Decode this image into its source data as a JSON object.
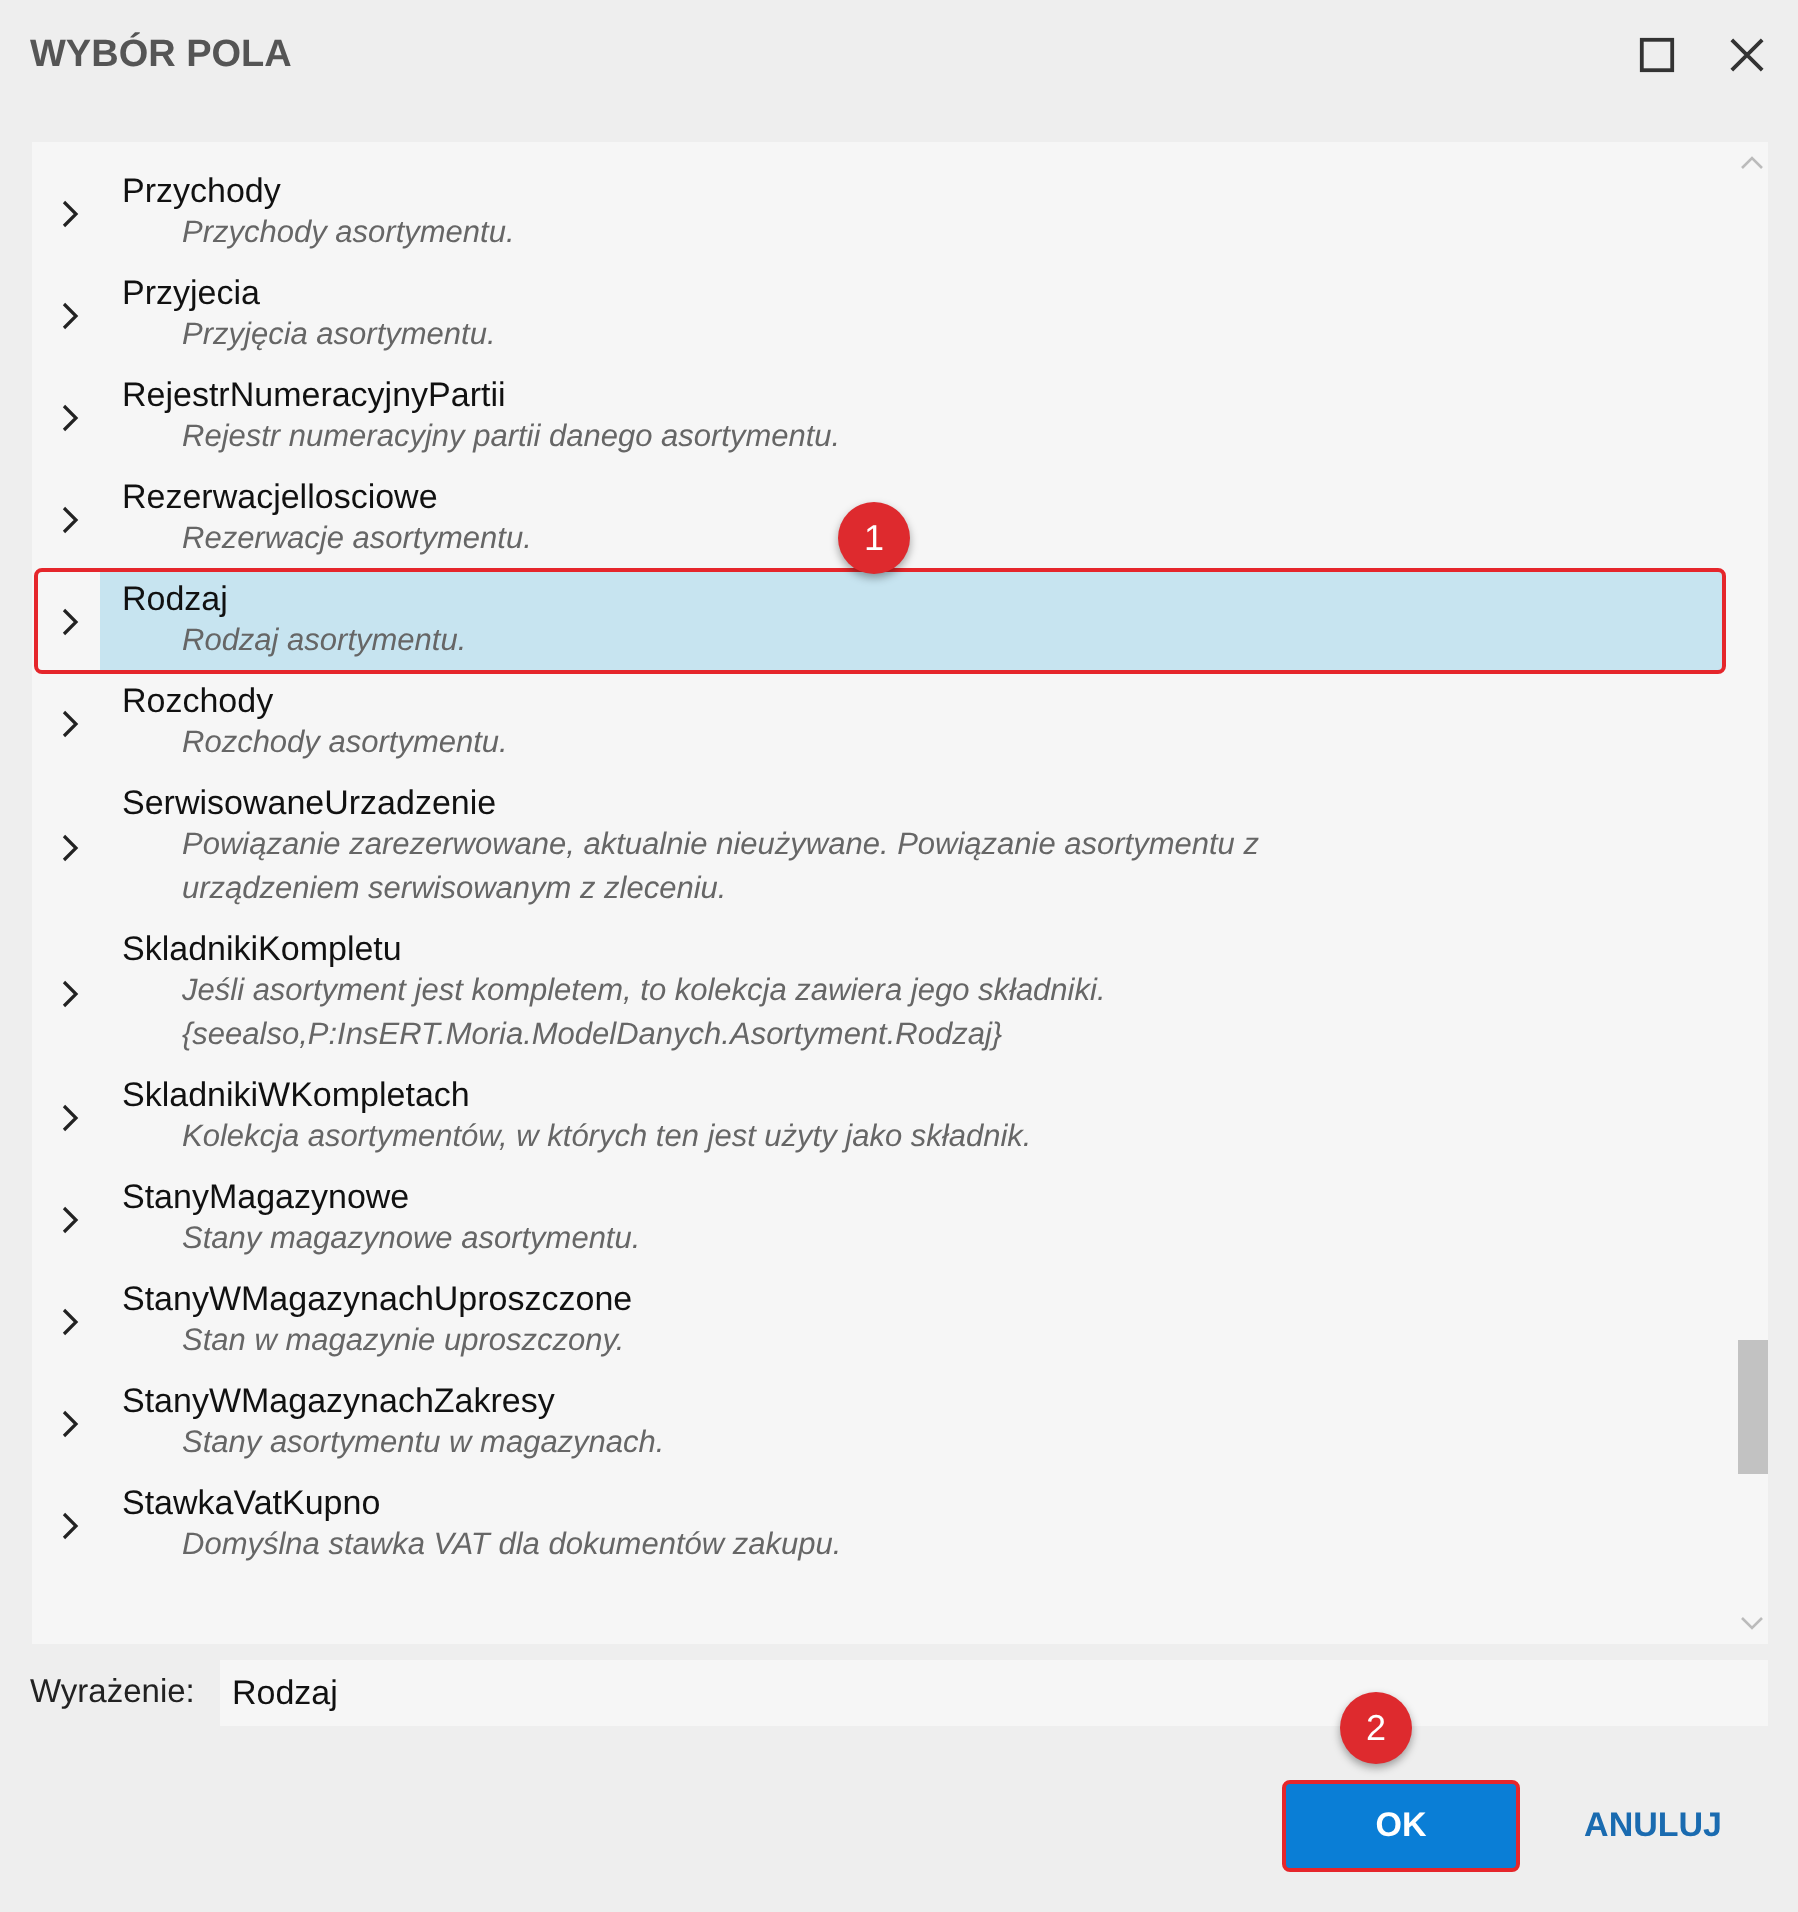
{
  "window": {
    "title": "WYBÓR POLA"
  },
  "fields": [
    {
      "name": "Przychody",
      "description": "Przychody asortymentu.",
      "selected": false,
      "outlined": false
    },
    {
      "name": "Przyjecia",
      "description": "Przyjęcia asortymentu.",
      "selected": false,
      "outlined": false
    },
    {
      "name": "RejestrNumeracyjnyPartii",
      "description": "Rejestr numeracyjny partii danego asortymentu.",
      "selected": false,
      "outlined": false
    },
    {
      "name": "Rezerwacjellosciowe",
      "description": "Rezerwacje asortymentu.",
      "selected": false,
      "outlined": false
    },
    {
      "name": "Rodzaj",
      "description": "Rodzaj asortymentu.",
      "selected": true,
      "outlined": true
    },
    {
      "name": "Rozchody",
      "description": "Rozchody asortymentu.",
      "selected": false,
      "outlined": false
    },
    {
      "name": "SerwisowaneUrzadzenie",
      "description": "Powiązanie zarezerwowane, aktualnie nieużywane. Powiązanie asortymentu z urządzeniem serwisowanym z zleceniu.",
      "selected": false,
      "outlined": false
    },
    {
      "name": "SkladnikiKompletu",
      "description": "Jeśli asortyment jest kompletem, to kolekcja zawiera jego składniki. {seealso,P:InsERT.Moria.ModelDanych.Asortyment.Rodzaj}",
      "selected": false,
      "outlined": false
    },
    {
      "name": "SkladnikiWKompletach",
      "description": "Kolekcja asortymentów, w których ten jest użyty jako składnik.",
      "selected": false,
      "outlined": false
    },
    {
      "name": "StanyMagazynowe",
      "description": "Stany magazynowe asortymentu.",
      "selected": false,
      "outlined": false
    },
    {
      "name": "StanyWMagazynachUproszczone",
      "description": "Stan w magazynie uproszczony.",
      "selected": false,
      "outlined": false
    },
    {
      "name": "StanyWMagazynachZakresy",
      "description": "Stany asortymentu w magazynach.",
      "selected": false,
      "outlined": false
    },
    {
      "name": "StawkaVatKupno",
      "description": "Domyślna stawka VAT dla dokumentów zakupu.",
      "selected": false,
      "outlined": false
    }
  ],
  "expression": {
    "label": "Wyrażenie:",
    "value": "Rodzaj"
  },
  "buttons": [
    {
      "label": "OK",
      "kind": "primary",
      "outlined": true
    },
    {
      "label": "ANULUJ",
      "kind": "text",
      "outlined": false
    }
  ],
  "markers": [
    {
      "label": "1"
    },
    {
      "label": "2"
    }
  ]
}
